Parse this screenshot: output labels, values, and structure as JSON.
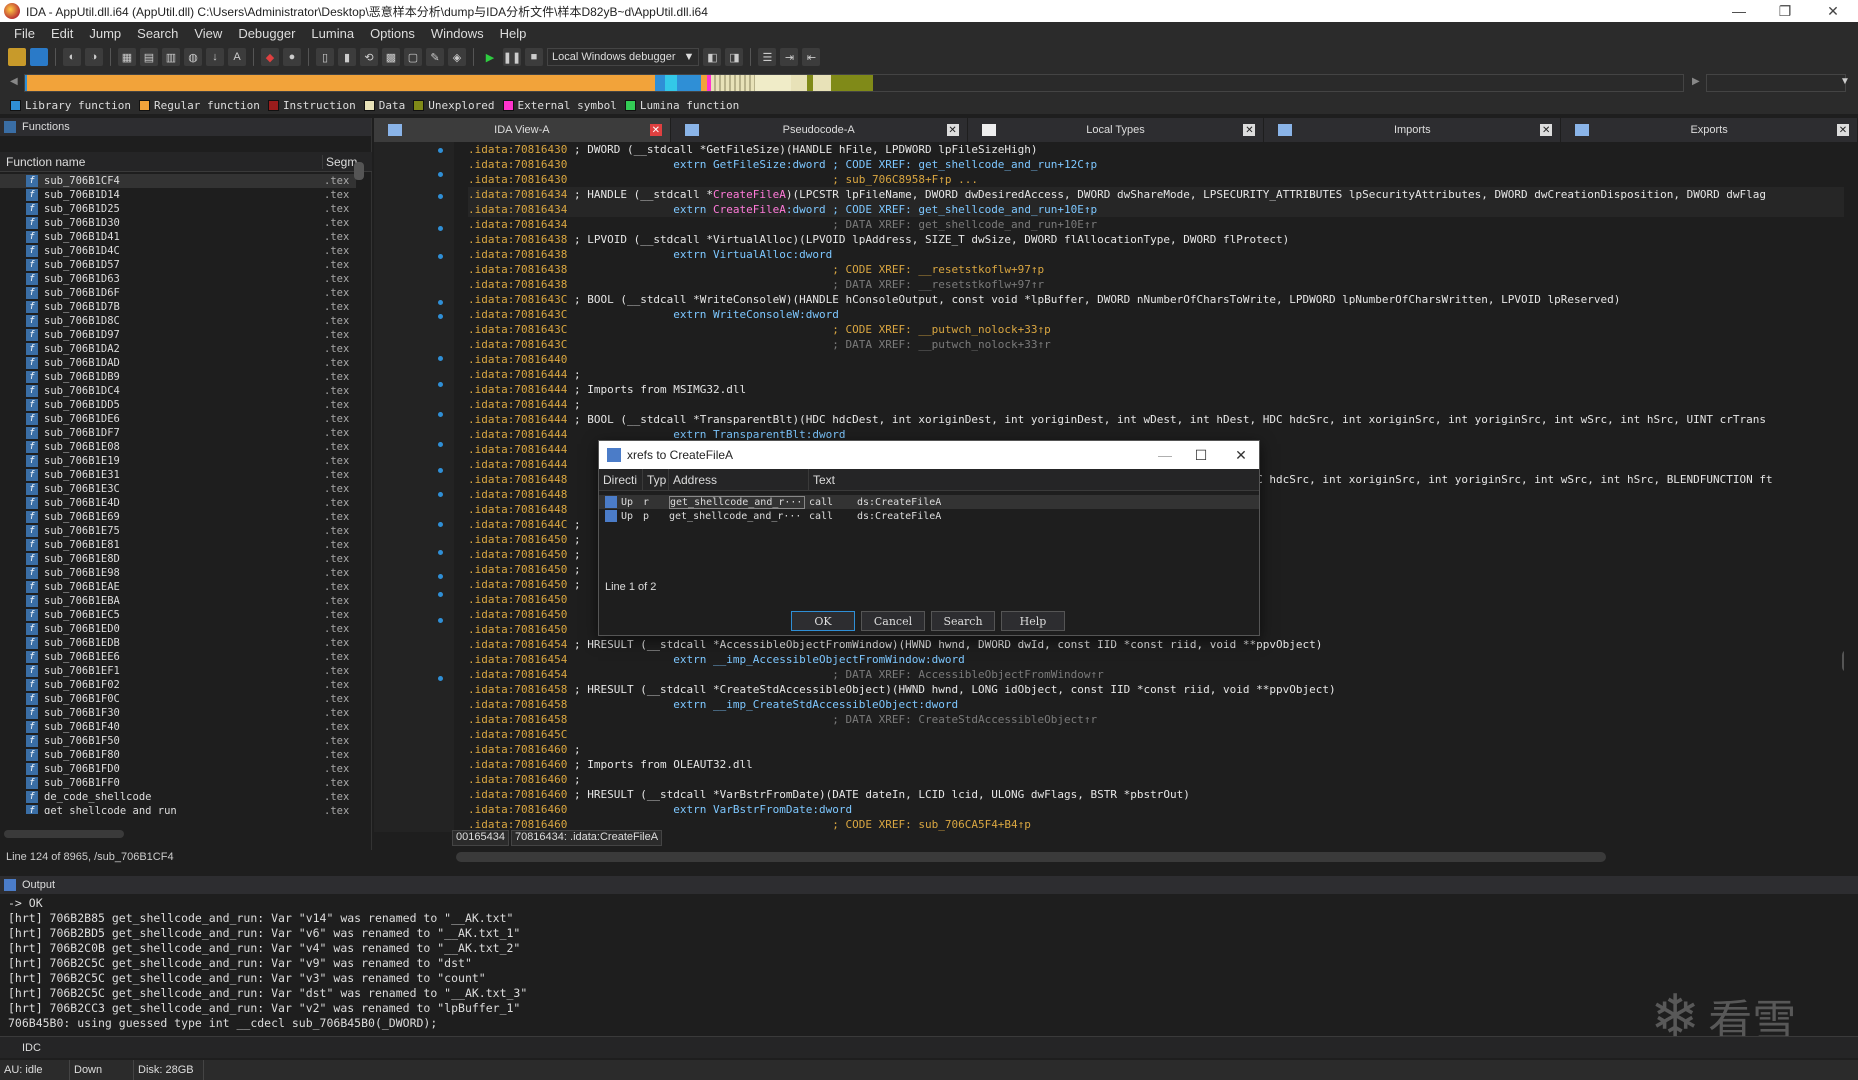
{
  "window": {
    "title": "IDA - AppUtil.dll.i64 (AppUtil.dll) C:\\Users\\Administrator\\Desktop\\恶意样本分析\\dump与IDA分析文件\\样本D82yB~d\\AppUtil.dll.i64",
    "minimize": "—",
    "restore": "❐",
    "close": "✕"
  },
  "menu": [
    "File",
    "Edit",
    "Jump",
    "Search",
    "View",
    "Debugger",
    "Lumina",
    "Options",
    "Windows",
    "Help"
  ],
  "toolbar": {
    "debugger": "Local Windows debugger"
  },
  "legend": [
    {
      "label": "Library function",
      "color": "#2f8fd6"
    },
    {
      "label": "Regular function",
      "color": "#f2a33a"
    },
    {
      "label": "Instruction",
      "color": "#9a1c1c"
    },
    {
      "label": "Data",
      "color": "#e8e2b8"
    },
    {
      "label": "Unexplored",
      "color": "#808a18"
    },
    {
      "label": "External symbol",
      "color": "#ff33cc"
    },
    {
      "label": "Lumina function",
      "color": "#33cc55"
    }
  ],
  "functions": {
    "title": "Functions",
    "col_name": "Function name",
    "col_seg": "Segm",
    "items": [
      "sub_706B1CF4",
      "sub_706B1D14",
      "sub_706B1D25",
      "sub_706B1D30",
      "sub_706B1D41",
      "sub_706B1D4C",
      "sub_706B1D57",
      "sub_706B1D63",
      "sub_706B1D6F",
      "sub_706B1D7B",
      "sub_706B1D8C",
      "sub_706B1D97",
      "sub_706B1DA2",
      "sub_706B1DAD",
      "sub_706B1DB9",
      "sub_706B1DC4",
      "sub_706B1DD5",
      "sub_706B1DE6",
      "sub_706B1DF7",
      "sub_706B1E08",
      "sub_706B1E19",
      "sub_706B1E31",
      "sub_706B1E3C",
      "sub_706B1E4D",
      "sub_706B1E69",
      "sub_706B1E75",
      "sub_706B1E81",
      "sub_706B1E8D",
      "sub_706B1E98",
      "sub_706B1EAE",
      "sub_706B1EBA",
      "sub_706B1EC5",
      "sub_706B1ED0",
      "sub_706B1EDB",
      "sub_706B1EE6",
      "sub_706B1EF1",
      "sub_706B1F02",
      "sub_706B1F0C",
      "sub_706B1F30",
      "sub_706B1F40",
      "sub_706B1F50",
      "sub_706B1F80",
      "sub_706B1FD0",
      "sub_706B1FF0",
      "de_code_shellcode",
      "get_shellcode_and_run"
    ],
    "seg": ".tex",
    "status": "Line 124 of 8965, /sub_706B1CF4"
  },
  "tabs": [
    "IDA View-A",
    "Pseudocode-A",
    "Local Types",
    "Imports",
    "Exports"
  ],
  "disasm": [
    [
      ".idata:70816430",
      " ; DWORD (__stdcall *GetFileSize)(HANDLE hFile, LPDWORD lpFileSizeHigh)",
      "code"
    ],
    [
      ".idata:70816430",
      "                extrn GetFileSize:dword ; CODE XREF: get_shellcode_and_run+12C↑p",
      "ext"
    ],
    [
      ".idata:70816430",
      "                                        ; sub_706C8958+F↑p ...",
      "cmt"
    ],
    [
      ".idata:70816434",
      " ; HANDLE (__stdcall *CreateFileA)(LPCSTR lpFileName, DWORD dwDesiredAccess, DWORD dwShareMode, LPSECURITY_ATTRIBUTES lpSecurityAttributes, DWORD dwCreationDisposition, DWORD dwFlag",
      "code"
    ],
    [
      ".idata:70816434",
      "                extrn CreateFileA:dword ; CODE XREF: get_shellcode_and_run+10E↑p",
      "ext"
    ],
    [
      ".idata:70816434",
      "                                        ; DATA XREF: get_shellcode_and_run+10E↑r",
      "cmt2"
    ],
    [
      ".idata:70816438",
      " ; LPVOID (__stdcall *VirtualAlloc)(LPVOID lpAddress, SIZE_T dwSize, DWORD flAllocationType, DWORD flProtect)",
      "code"
    ],
    [
      ".idata:70816438",
      "                extrn VirtualAlloc:dword",
      "ext"
    ],
    [
      ".idata:70816438",
      "                                        ; CODE XREF: __resetstkoflw+97↑p",
      "cmt"
    ],
    [
      ".idata:70816438",
      "                                        ; DATA XREF: __resetstkoflw+97↑r",
      "cmt2"
    ],
    [
      ".idata:7081643C",
      " ; BOOL (__stdcall *WriteConsoleW)(HANDLE hConsoleOutput, const void *lpBuffer, DWORD nNumberOfCharsToWrite, LPDWORD lpNumberOfCharsWritten, LPVOID lpReserved)",
      "code"
    ],
    [
      ".idata:7081643C",
      "                extrn WriteConsoleW:dword",
      "ext"
    ],
    [
      ".idata:7081643C",
      "                                        ; CODE XREF: __putwch_nolock+33↑p",
      "cmt"
    ],
    [
      ".idata:7081643C",
      "                                        ; DATA XREF: __putwch_nolock+33↑r",
      "cmt2"
    ],
    [
      ".idata:70816440",
      "",
      "code"
    ],
    [
      ".idata:70816444",
      " ;",
      "code"
    ],
    [
      ".idata:70816444",
      " ; Imports from MSIMG32.dll",
      "code"
    ],
    [
      ".idata:70816444",
      " ;",
      "code"
    ],
    [
      ".idata:70816444",
      " ; BOOL (__stdcall *TransparentBlt)(HDC hdcDest, int xoriginDest, int yoriginDest, int wDest, int hDest, HDC hdcSrc, int xoriginSrc, int yoriginSrc, int wSrc, int hSrc, UINT crTrans",
      "code"
    ],
    [
      ".idata:70816444",
      "                extrn TransparentBlt:dword",
      "ext"
    ],
    [
      ".idata:70816444",
      "",
      "code"
    ],
    [
      ".idata:70816444",
      "",
      "code"
    ],
    [
      ".idata:70816448",
      "                                                                                                   t, HDC hdcSrc, int xoriginSrc, int yoriginSrc, int wSrc, int hSrc, BLENDFUNCTION ft",
      "code"
    ],
    [
      ".idata:70816448",
      "",
      "code"
    ],
    [
      ".idata:70816448",
      "",
      "code"
    ],
    [
      ".idata:7081644C",
      " ;",
      "code"
    ],
    [
      ".idata:70816450",
      " ;",
      "code"
    ],
    [
      ".idata:70816450",
      " ;",
      "code"
    ],
    [
      ".idata:70816450",
      " ;",
      "code"
    ],
    [
      ".idata:70816450",
      " ;",
      "code"
    ],
    [
      ".idata:70816450",
      "",
      "code"
    ],
    [
      ".idata:70816450",
      "",
      "code"
    ],
    [
      ".idata:70816450",
      "",
      "code"
    ],
    [
      ".idata:70816454",
      " ; HRESULT (__stdcall *AccessibleObjectFromWindow)(HWND hwnd, DWORD dwId, const IID *const riid, void **ppvObject)",
      "code"
    ],
    [
      ".idata:70816454",
      "                extrn __imp_AccessibleObjectFromWindow:dword",
      "ext"
    ],
    [
      ".idata:70816454",
      "                                        ; DATA XREF: AccessibleObjectFromWindow↑r",
      "cmt2"
    ],
    [
      ".idata:70816458",
      " ; HRESULT (__stdcall *CreateStdAccessibleObject)(HWND hwnd, LONG idObject, const IID *const riid, void **ppvObject)",
      "code"
    ],
    [
      ".idata:70816458",
      "                extrn __imp_CreateStdAccessibleObject:dword",
      "ext"
    ],
    [
      ".idata:70816458",
      "                                        ; DATA XREF: CreateStdAccessibleObject↑r",
      "cmt2"
    ],
    [
      ".idata:7081645C",
      "",
      "code"
    ],
    [
      ".idata:70816460",
      " ;",
      "code"
    ],
    [
      ".idata:70816460",
      " ; Imports from OLEAUT32.dll",
      "code"
    ],
    [
      ".idata:70816460",
      " ;",
      "code"
    ],
    [
      ".idata:70816460",
      " ; HRESULT (__stdcall *VarBstrFromDate)(DATE dateIn, LCID lcid, ULONG dwFlags, BSTR *pbstrOut)",
      "code"
    ],
    [
      ".idata:70816460",
      "                extrn VarBstrFromDate:dword",
      "ext"
    ],
    [
      ".idata:70816460",
      "                                        ; CODE XREF: sub_706CA5F4+B4↑p",
      "cmt"
    ]
  ],
  "disasm_status": [
    "00165434",
    "70816434: .idata:CreateFileA"
  ],
  "dialog": {
    "title": "xrefs to CreateFileA",
    "cols": [
      "Directi",
      "Typ",
      "Address",
      "Text"
    ],
    "rows": [
      {
        "dir": "Up",
        "type": "r",
        "address": "get_shellcode_and_r···",
        "op": "call",
        "text": "ds:CreateFileA"
      },
      {
        "dir": "Up",
        "type": "p",
        "address": "get_shellcode_and_r···",
        "op": "call",
        "text": "ds:CreateFileA"
      }
    ],
    "status": "Line 1 of 2",
    "buttons": [
      "OK",
      "Cancel",
      "Search",
      "Help"
    ]
  },
  "output": {
    "title": "Output",
    "lines": [
      "-> OK",
      "[hrt] 706B2B85 get_shellcode_and_run: Var \"v14\" was renamed to \"__AK.txt\"",
      "[hrt] 706B2BD5 get_shellcode_and_run: Var \"v6\" was renamed to \"__AK.txt_1\"",
      "[hrt] 706B2C0B get_shellcode_and_run: Var \"v4\" was renamed to \"__AK.txt_2\"",
      "[hrt] 706B2C5C get_shellcode_and_run: Var \"v9\" was renamed to \"dst\"",
      "[hrt] 706B2C5C get_shellcode_and_run: Var \"v3\" was renamed to \"count\"",
      "[hrt] 706B2C5C get_shellcode_and_run: Var \"dst\" was renamed to \"__AK.txt_3\"",
      "[hrt] 706B2CC3 get_shellcode_and_run: Var \"v2\" was renamed to \"lpBuffer_1\"",
      "706B45B0: using guessed type int __cdecl sub_706B45B0(_DWORD);"
    ],
    "idc": "IDC"
  },
  "status": {
    "au": "AU:  idle",
    "dir": "Down",
    "disk": "Disk: 28GB"
  },
  "watermark": "看雪"
}
